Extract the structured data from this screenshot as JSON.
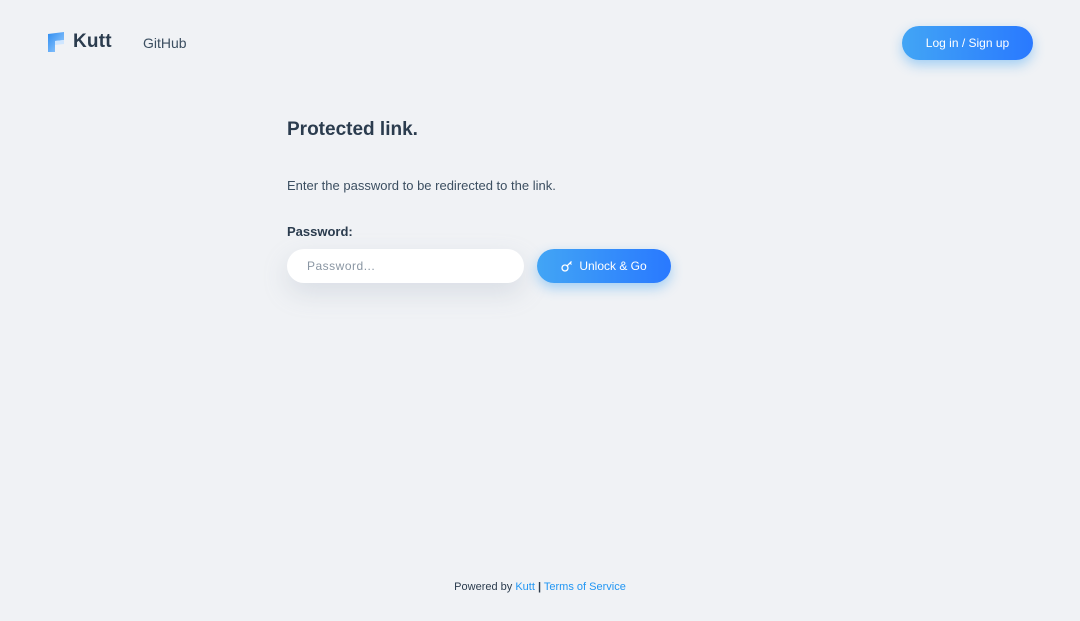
{
  "header": {
    "logo_text": "Kutt",
    "nav": {
      "github_label": "GitHub"
    },
    "login_label": "Log in / Sign up"
  },
  "main": {
    "title": "Protected link.",
    "description": "Enter the password to be redirected to the link.",
    "password_label": "Password:",
    "password_input": {
      "value": "",
      "placeholder": "Password..."
    },
    "unlock_button": {
      "label": "Unlock & Go",
      "icon": "key-icon"
    }
  },
  "footer": {
    "prefix": "Powered by",
    "kutt_link": "Kutt",
    "separator": "|",
    "terms_link": "Terms of Service"
  },
  "colors": {
    "background": "#f0f2f5",
    "accent_start": "#42a5f5",
    "accent_end": "#2979ff",
    "link": "#2196f3",
    "text_dark": "#2b3c4e"
  }
}
